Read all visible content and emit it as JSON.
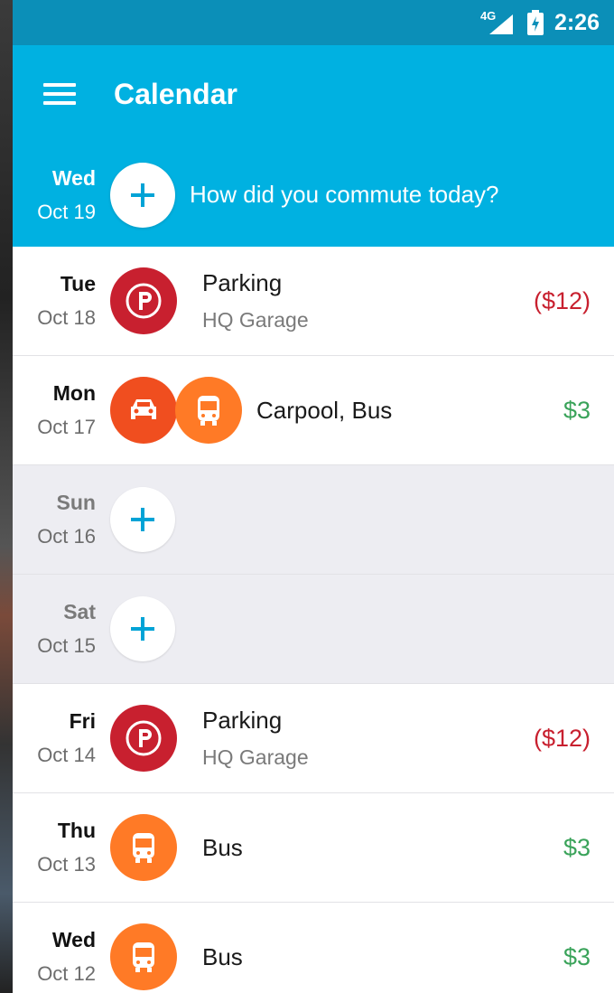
{
  "colors": {
    "status_bar": "#0b8fb8",
    "app_bar": "#00b1e1",
    "parking": "#c8202f",
    "carpool": "#f04e1f",
    "bus": "#ff7a26",
    "negative": "#c8202f",
    "positive": "#3aa35a",
    "empty_row": "#ededf2"
  },
  "status_bar": {
    "network": "4G",
    "time": "2:26"
  },
  "app_bar": {
    "title": "Calendar",
    "menu_icon": "hamburger-menu-icon"
  },
  "today": {
    "dow": "Wed",
    "date": "Oct 19",
    "prompt": "How did you commute today?",
    "add_icon": "plus-icon"
  },
  "entries": [
    {
      "dow": "Tue",
      "date": "Oct 18",
      "title": "Parking",
      "subtitle": "HQ Garage",
      "amount": "($12)",
      "amount_type": "negative",
      "icons": [
        "parking-icon"
      ]
    },
    {
      "dow": "Mon",
      "date": "Oct 17",
      "title": "Carpool, Bus",
      "subtitle": "",
      "amount": "$3",
      "amount_type": "positive",
      "icons": [
        "car-icon",
        "bus-icon"
      ]
    },
    {
      "dow": "Sun",
      "date": "Oct 16",
      "empty": true,
      "icons": [
        "plus-icon"
      ]
    },
    {
      "dow": "Sat",
      "date": "Oct 15",
      "empty": true,
      "icons": [
        "plus-icon"
      ]
    },
    {
      "dow": "Fri",
      "date": "Oct 14",
      "title": "Parking",
      "subtitle": "HQ Garage",
      "amount": "($12)",
      "amount_type": "negative",
      "icons": [
        "parking-icon"
      ]
    },
    {
      "dow": "Thu",
      "date": "Oct 13",
      "title": "Bus",
      "subtitle": "",
      "amount": "$3",
      "amount_type": "positive",
      "icons": [
        "bus-icon"
      ]
    },
    {
      "dow": "Wed",
      "date": "Oct 12",
      "title": "Bus",
      "subtitle": "",
      "amount": "$3",
      "amount_type": "positive",
      "icons": [
        "bus-icon"
      ]
    }
  ]
}
